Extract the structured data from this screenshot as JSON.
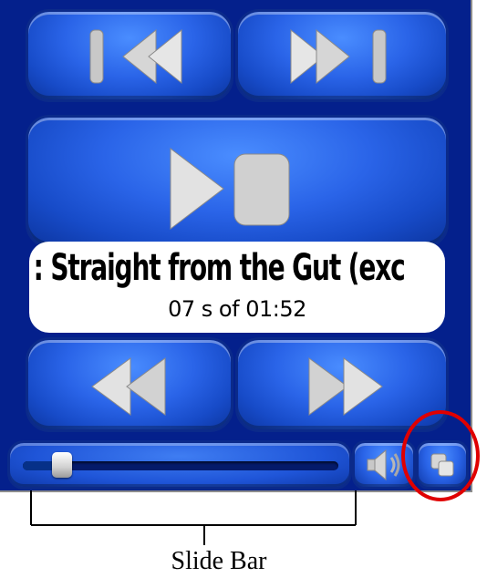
{
  "player": {
    "track_title": ": Straight from the Gut (exc",
    "time_text": "07 s of 01:52",
    "progress_fraction": 0.07,
    "buttons": {
      "previous": "previous-track",
      "next": "next-track",
      "play": "play",
      "stop": "stop",
      "rewind": "rewind",
      "fast_forward": "fast-forward",
      "volume": "volume",
      "window_toggle": "window-toggle"
    }
  },
  "annotation": {
    "caption": "Slide Bar"
  },
  "colors": {
    "button_blue": "#2a64e8",
    "panel_navy": "#04208c",
    "highlight_red": "#e00000"
  }
}
